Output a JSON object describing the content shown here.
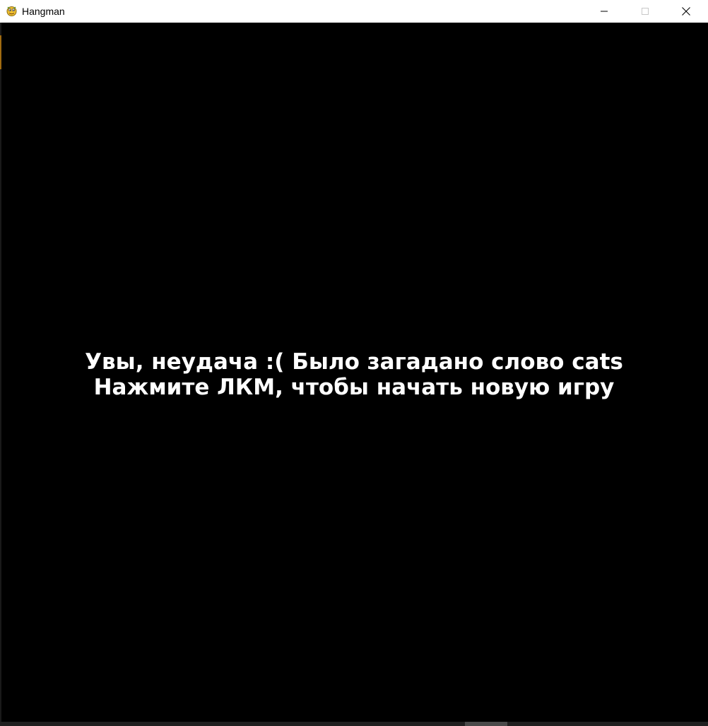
{
  "window": {
    "title": "Hangman",
    "icon": "pygame-snake-icon",
    "controls": {
      "minimize_icon": "minimize-icon",
      "maximize_icon": "maximize-icon",
      "close_icon": "close-icon"
    }
  },
  "game": {
    "background_color": "#000000",
    "text_color": "#ffffff",
    "message_line1": "Увы, неудача :( Было загадано слово cats",
    "message_line2": "Нажмите ЛКМ, чтобы начать новую игру"
  }
}
